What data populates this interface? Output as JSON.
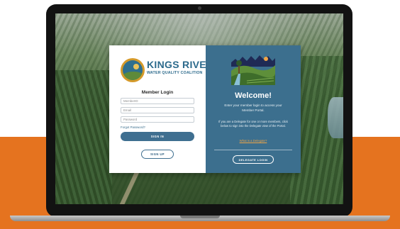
{
  "logo": {
    "title": "KINGS RIVER",
    "subtitle": "WATER QUALITY COALITION"
  },
  "login": {
    "heading": "Member Login",
    "member_id_placeholder": "MemberID",
    "email_placeholder": "Email",
    "password_placeholder": "Password",
    "forgot_password": "Forgot Password?",
    "sign_in_label": "SIGN IN",
    "sign_up_label": "SIGN UP"
  },
  "welcome": {
    "title": "Welcome!",
    "text": "Enter your member login to access your Member Portal.",
    "delegate_text": "If you are a Delegate for one or more members, click below to sign into the Delegate view of the Portal.",
    "delegate_question": "What is a Delegate?",
    "delegate_button": "DELEGATE LOGIN"
  },
  "colors": {
    "accent_blue": "#3c6f8e",
    "brand_orange": "#e5731f",
    "link_orange": "#f0a546"
  }
}
